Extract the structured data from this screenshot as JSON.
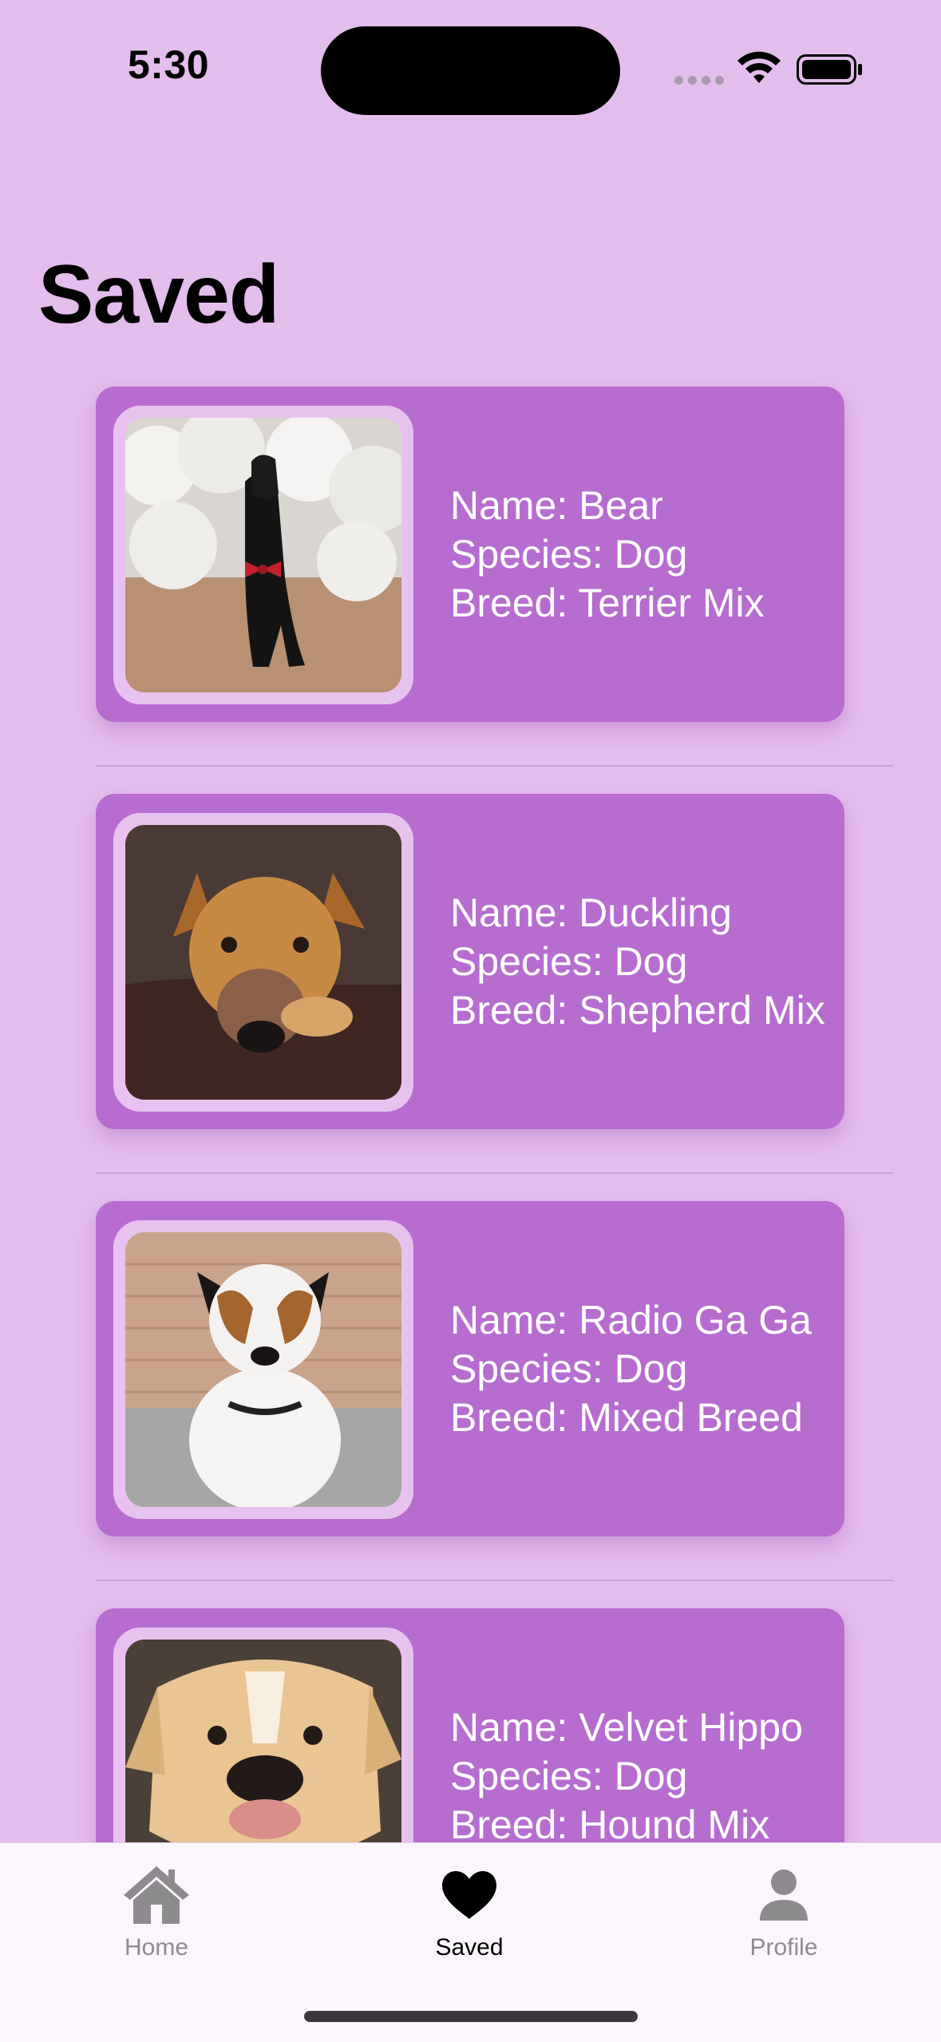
{
  "status_bar": {
    "time": "5:30"
  },
  "header": {
    "title": "Saved"
  },
  "pets": [
    {
      "name": "Name: Bear",
      "species": "Species: Dog",
      "breed": "Breed: Terrier Mix"
    },
    {
      "name": "Name: Duckling",
      "species": "Species: Dog",
      "breed": "Breed: Shepherd Mix"
    },
    {
      "name": "Name: Radio Ga Ga",
      "species": "Species: Dog",
      "breed": "Breed: Mixed Breed"
    },
    {
      "name": "Name: Velvet Hippo",
      "species": "Species: Dog",
      "breed": "Breed: Hound Mix"
    }
  ],
  "tabbar": {
    "tabs": [
      {
        "label": "Home",
        "icon": "house-icon",
        "active": false
      },
      {
        "label": "Saved",
        "icon": "heart-icon",
        "active": true
      },
      {
        "label": "Profile",
        "icon": "person-icon",
        "active": false
      }
    ]
  },
  "colors": {
    "background": "#E3BDEC",
    "card": "#B76DCF",
    "photo_frame": "#E7C2EE",
    "tab_active": "#000000",
    "tab_inactive": "#8E8B8F"
  }
}
